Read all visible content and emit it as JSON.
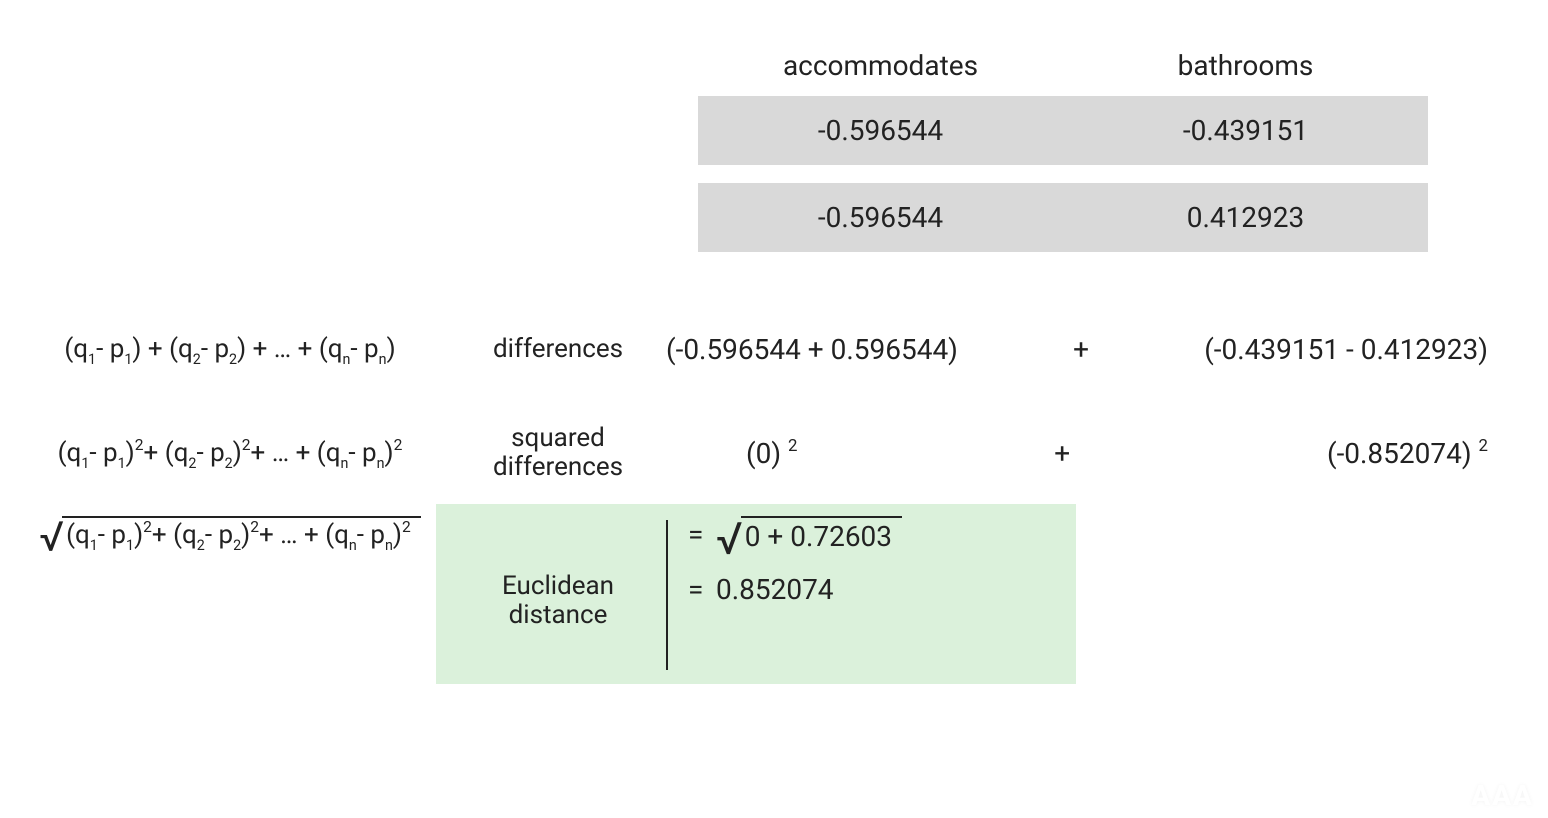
{
  "table": {
    "headers": [
      "accommodates",
      "bathrooms"
    ],
    "rows": [
      [
        "-0.596544",
        "-0.439151"
      ],
      [
        "-0.596544",
        "0.412923"
      ]
    ]
  },
  "labels": {
    "differences": "differences",
    "squared_differences_line1": "squared",
    "squared_differences_line2": "differences",
    "euclidean_line1": "Euclidean",
    "euclidean_line2": "distance"
  },
  "formulas": {
    "differences": "(q₁ - p₁) + (q₂ - p₂) + … + (qₙ - pₙ)",
    "squared": "(q₁ - p₁)² + (q₂ - p₂)² + … + (qₙ - pₙ)²",
    "euclidean_body": "(q₁ - p₁)² + (q₂ - p₂)² + … + (qₙ - pₙ)²"
  },
  "calc": {
    "differences_left": "(-0.596544 + 0.596544)",
    "differences_right": "(-0.439151 - 0.412923)",
    "plus": "+",
    "squared_left_base": "(0)",
    "squared_right_base": "(-0.852074)",
    "squared_exp": "2",
    "euclid_sqrt_body": "0 +  0.72603",
    "euclid_equals": "=",
    "euclid_result": "0.852074"
  },
  "chart_data": {
    "type": "table",
    "columns": [
      "accommodates",
      "bathrooms"
    ],
    "row_q": [
      -0.596544,
      -0.439151
    ],
    "row_p": [
      -0.596544,
      0.412923
    ],
    "differences": [
      0.0,
      -0.852074
    ],
    "squared_differences": [
      0.0,
      0.72603
    ],
    "sum_squared": 0.72603,
    "euclidean_distance": 0.852074
  },
  "watermark": "AAA"
}
